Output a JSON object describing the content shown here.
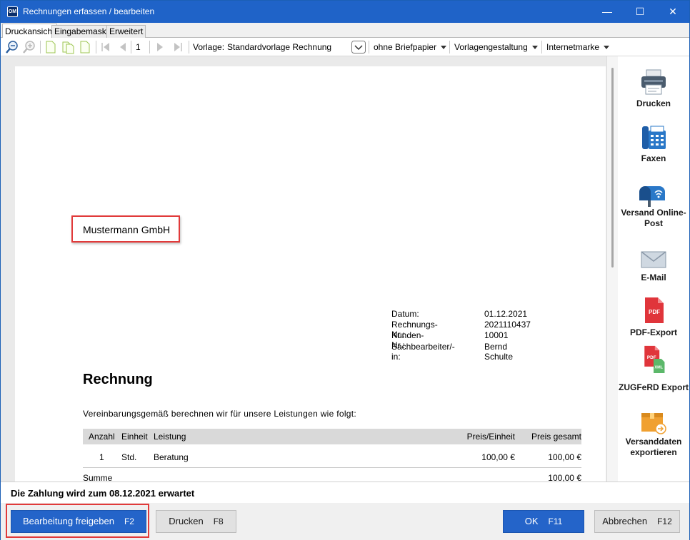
{
  "window": {
    "app_icon_text": "OM",
    "title": "Rechnungen erfassen / bearbeiten",
    "controls": {
      "minimize": "—",
      "maximize": "☐",
      "close": "✕"
    }
  },
  "tabs": [
    {
      "label": "Druckansicht",
      "active": true
    },
    {
      "label": "Eingabemaske",
      "active": false
    },
    {
      "label": "Erweitert",
      "active": false
    }
  ],
  "toolbar": {
    "page_number": "1",
    "template_label": "Vorlage:",
    "template_value": "Standardvorlage Rechnung",
    "letterhead": "ohne Briefpapier",
    "template_design": "Vorlagengestaltung",
    "postage": "Internetmarke",
    "icons": [
      "zoom-out-icon",
      "zoom-in-icon",
      "page-single-icon",
      "page-double-icon",
      "page-fit-icon",
      "first-page-icon",
      "prev-page-icon",
      "next-page-icon",
      "last-page-icon",
      "template-dropdown-icon"
    ]
  },
  "document": {
    "company": "Mustermann GmbH",
    "meta": [
      {
        "label": "Datum:",
        "value": "01.12.2021"
      },
      {
        "label": "Rechnungs-Nr.:",
        "value": "2021110437"
      },
      {
        "label": "Kunden-Nr.:",
        "value": "10001"
      },
      {
        "label": "Sachbearbeiter/-in:",
        "value": "Bernd Schulte"
      }
    ],
    "title": "Rechnung",
    "intro": "Vereinbarungsgemäß berechnen wir für unsere Leistungen wie folgt:",
    "table": {
      "headers": {
        "qty": "Anzahl",
        "unit": "Einheit",
        "service": "Leistung",
        "unit_price": "Preis/Einheit",
        "total": "Preis gesamt"
      },
      "rows": [
        {
          "qty": "1",
          "unit": "Std.",
          "service": "Beratung",
          "unit_price": "100,00 €",
          "total": "100,00 €"
        }
      ],
      "sum_label": "Summe",
      "sum_value": "100,00 €"
    }
  },
  "sidebar": [
    {
      "label": "Drucken",
      "icon": "printer-icon"
    },
    {
      "label": "Faxen",
      "icon": "fax-icon"
    },
    {
      "label": "Versand Online-Post",
      "icon": "mailbox-icon"
    },
    {
      "label": "E-Mail",
      "icon": "envelope-icon"
    },
    {
      "label": "PDF-Export",
      "icon": "pdf-icon"
    },
    {
      "label": "ZUGFeRD Export",
      "icon": "pdf-xml-icon"
    },
    {
      "label": "Versanddaten exportieren",
      "icon": "box-export-icon"
    }
  ],
  "status": "Die Zahlung wird zum 08.12.2021 erwartet",
  "buttons": {
    "release": {
      "label": "Bearbeitung freigeben",
      "key": "F2"
    },
    "print": {
      "label": "Drucken",
      "key": "F8"
    },
    "ok": {
      "label": "OK",
      "key": "F11"
    },
    "cancel": {
      "label": "Abbrechen",
      "key": "F12"
    }
  },
  "colors": {
    "titlebar": "#1f63c8",
    "primary_button": "#2464c9",
    "highlight": "#e13a3a",
    "pdf_red": "#e0353b"
  }
}
